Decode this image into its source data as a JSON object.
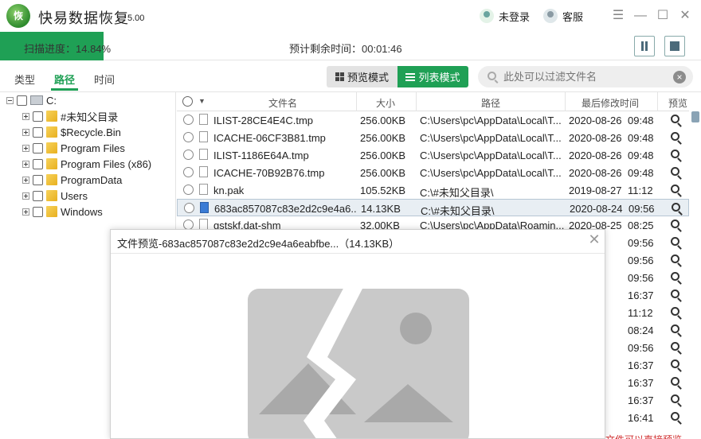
{
  "app": {
    "logo_text": "恢",
    "title": "快易数据恢复",
    "version": "5.00",
    "login_label": "未登录",
    "service_label": "客服",
    "window_controls": [
      "menu-icon",
      "minimize-icon",
      "maximize-icon",
      "close-icon"
    ]
  },
  "scan": {
    "progress_text": "扫描进度：14.84%",
    "progress_value": 0.1484,
    "remaining_text": "预计剩余时间：00:01:46",
    "pause_icon": "pause-icon",
    "stop_icon": "stop-icon"
  },
  "tabs": [
    {
      "label": "类型",
      "active": false
    },
    {
      "label": "路径",
      "active": true
    },
    {
      "label": "时间",
      "active": false
    }
  ],
  "view_modes": [
    {
      "label": "预览模式",
      "icon": "grid-icon",
      "active": false
    },
    {
      "label": "列表模式",
      "icon": "list-icon",
      "active": true
    }
  ],
  "filter": {
    "placeholder": "此处可以过滤文件名",
    "value": ""
  },
  "tree": {
    "root": "C:",
    "items": [
      "#未知父目录",
      "$Recycle.Bin",
      "Program Files",
      "Program Files (x86)",
      "ProgramData",
      "Users",
      "Windows"
    ]
  },
  "columns": [
    "文件名",
    "大小",
    "路径",
    "最后修改时间",
    "预览"
  ],
  "files": [
    {
      "name": "ILIST-28CE4E4C.tmp",
      "size": "256.00KB",
      "path": "C:\\Users\\pc\\AppData\\Local\\T...",
      "date": "2020-08-26",
      "time": "09:48"
    },
    {
      "name": "ICACHE-06CF3B81.tmp",
      "size": "256.00KB",
      "path": "C:\\Users\\pc\\AppData\\Local\\T...",
      "date": "2020-08-26",
      "time": "09:48"
    },
    {
      "name": "ILIST-1186E64A.tmp",
      "size": "256.00KB",
      "path": "C:\\Users\\pc\\AppData\\Local\\T...",
      "date": "2020-08-26",
      "time": "09:48"
    },
    {
      "name": "ICACHE-70B92B76.tmp",
      "size": "256.00KB",
      "path": "C:\\Users\\pc\\AppData\\Local\\T...",
      "date": "2020-08-26",
      "time": "09:48"
    },
    {
      "name": "kn.pak",
      "size": "105.52KB",
      "path": "C:\\#未知父目录\\",
      "date": "2019-08-27",
      "time": "11:12"
    },
    {
      "name": "683ac857087c83e2d2c9e4a6...",
      "size": "14.13KB",
      "path": "C:\\#未知父目录\\",
      "date": "2020-08-24",
      "time": "09:56"
    },
    {
      "name": "gstskf.dat-shm",
      "size": "32.00KB",
      "path": "C:\\Users\\pc\\AppData\\Roamin...",
      "date": "2020-08-25",
      "time": "08:25"
    },
    {
      "name": "",
      "size": "",
      "path": "",
      "date": "-24",
      "time": "09:56"
    },
    {
      "name": "",
      "size": "",
      "path": "",
      "date": "-24",
      "time": "09:56"
    },
    {
      "name": "",
      "size": "",
      "path": "",
      "date": "-24",
      "time": "09:56"
    },
    {
      "name": "",
      "size": "",
      "path": "",
      "date": "-25",
      "time": "16:37"
    },
    {
      "name": "",
      "size": "",
      "path": "",
      "date": "-27",
      "time": "11:12"
    },
    {
      "name": "",
      "size": "",
      "path": "",
      "date": "-25",
      "time": "08:24"
    },
    {
      "name": "",
      "size": "",
      "path": "",
      "date": "-24",
      "time": "09:56"
    },
    {
      "name": "",
      "size": "",
      "path": "",
      "date": "-25",
      "time": "16:37"
    },
    {
      "name": "",
      "size": "",
      "path": "",
      "date": "-25",
      "time": "16:37"
    },
    {
      "name": "",
      "size": "",
      "path": "",
      "date": "-25",
      "time": "16:37"
    },
    {
      "name": "",
      "size": "",
      "path": "",
      "date": "-25",
      "time": "16:41"
    }
  ],
  "selected_row": 5,
  "hint_text": "文件可以直接预览",
  "preview_dialog": {
    "title": "文件预览-683ac857087c83e2d2c9e4a6eabfbe...（14.13KB）",
    "image_state": "broken-image-icon"
  },
  "colors": {
    "accent": "#1fa055",
    "progress_track": "#dff0e3",
    "selected_row": "#e8eef3",
    "hint": "#d03030"
  }
}
